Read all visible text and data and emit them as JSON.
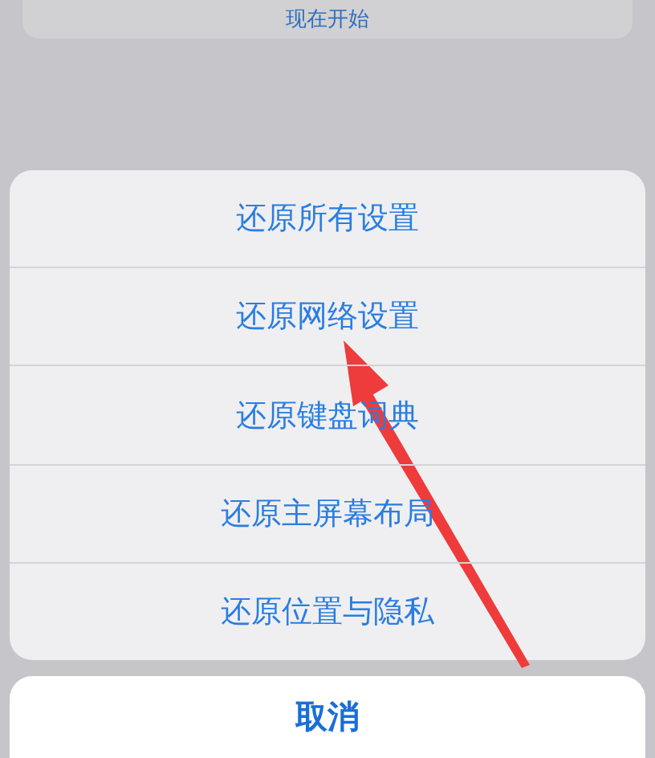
{
  "background_button": {
    "label": "现在开始"
  },
  "action_sheet": {
    "items": [
      {
        "label": "还原所有设置"
      },
      {
        "label": "还原网络设置"
      },
      {
        "label": "还原键盘词典"
      },
      {
        "label": "还原主屏幕布局"
      },
      {
        "label": "还原位置与隐私"
      }
    ],
    "cancel": {
      "label": "取消"
    }
  }
}
